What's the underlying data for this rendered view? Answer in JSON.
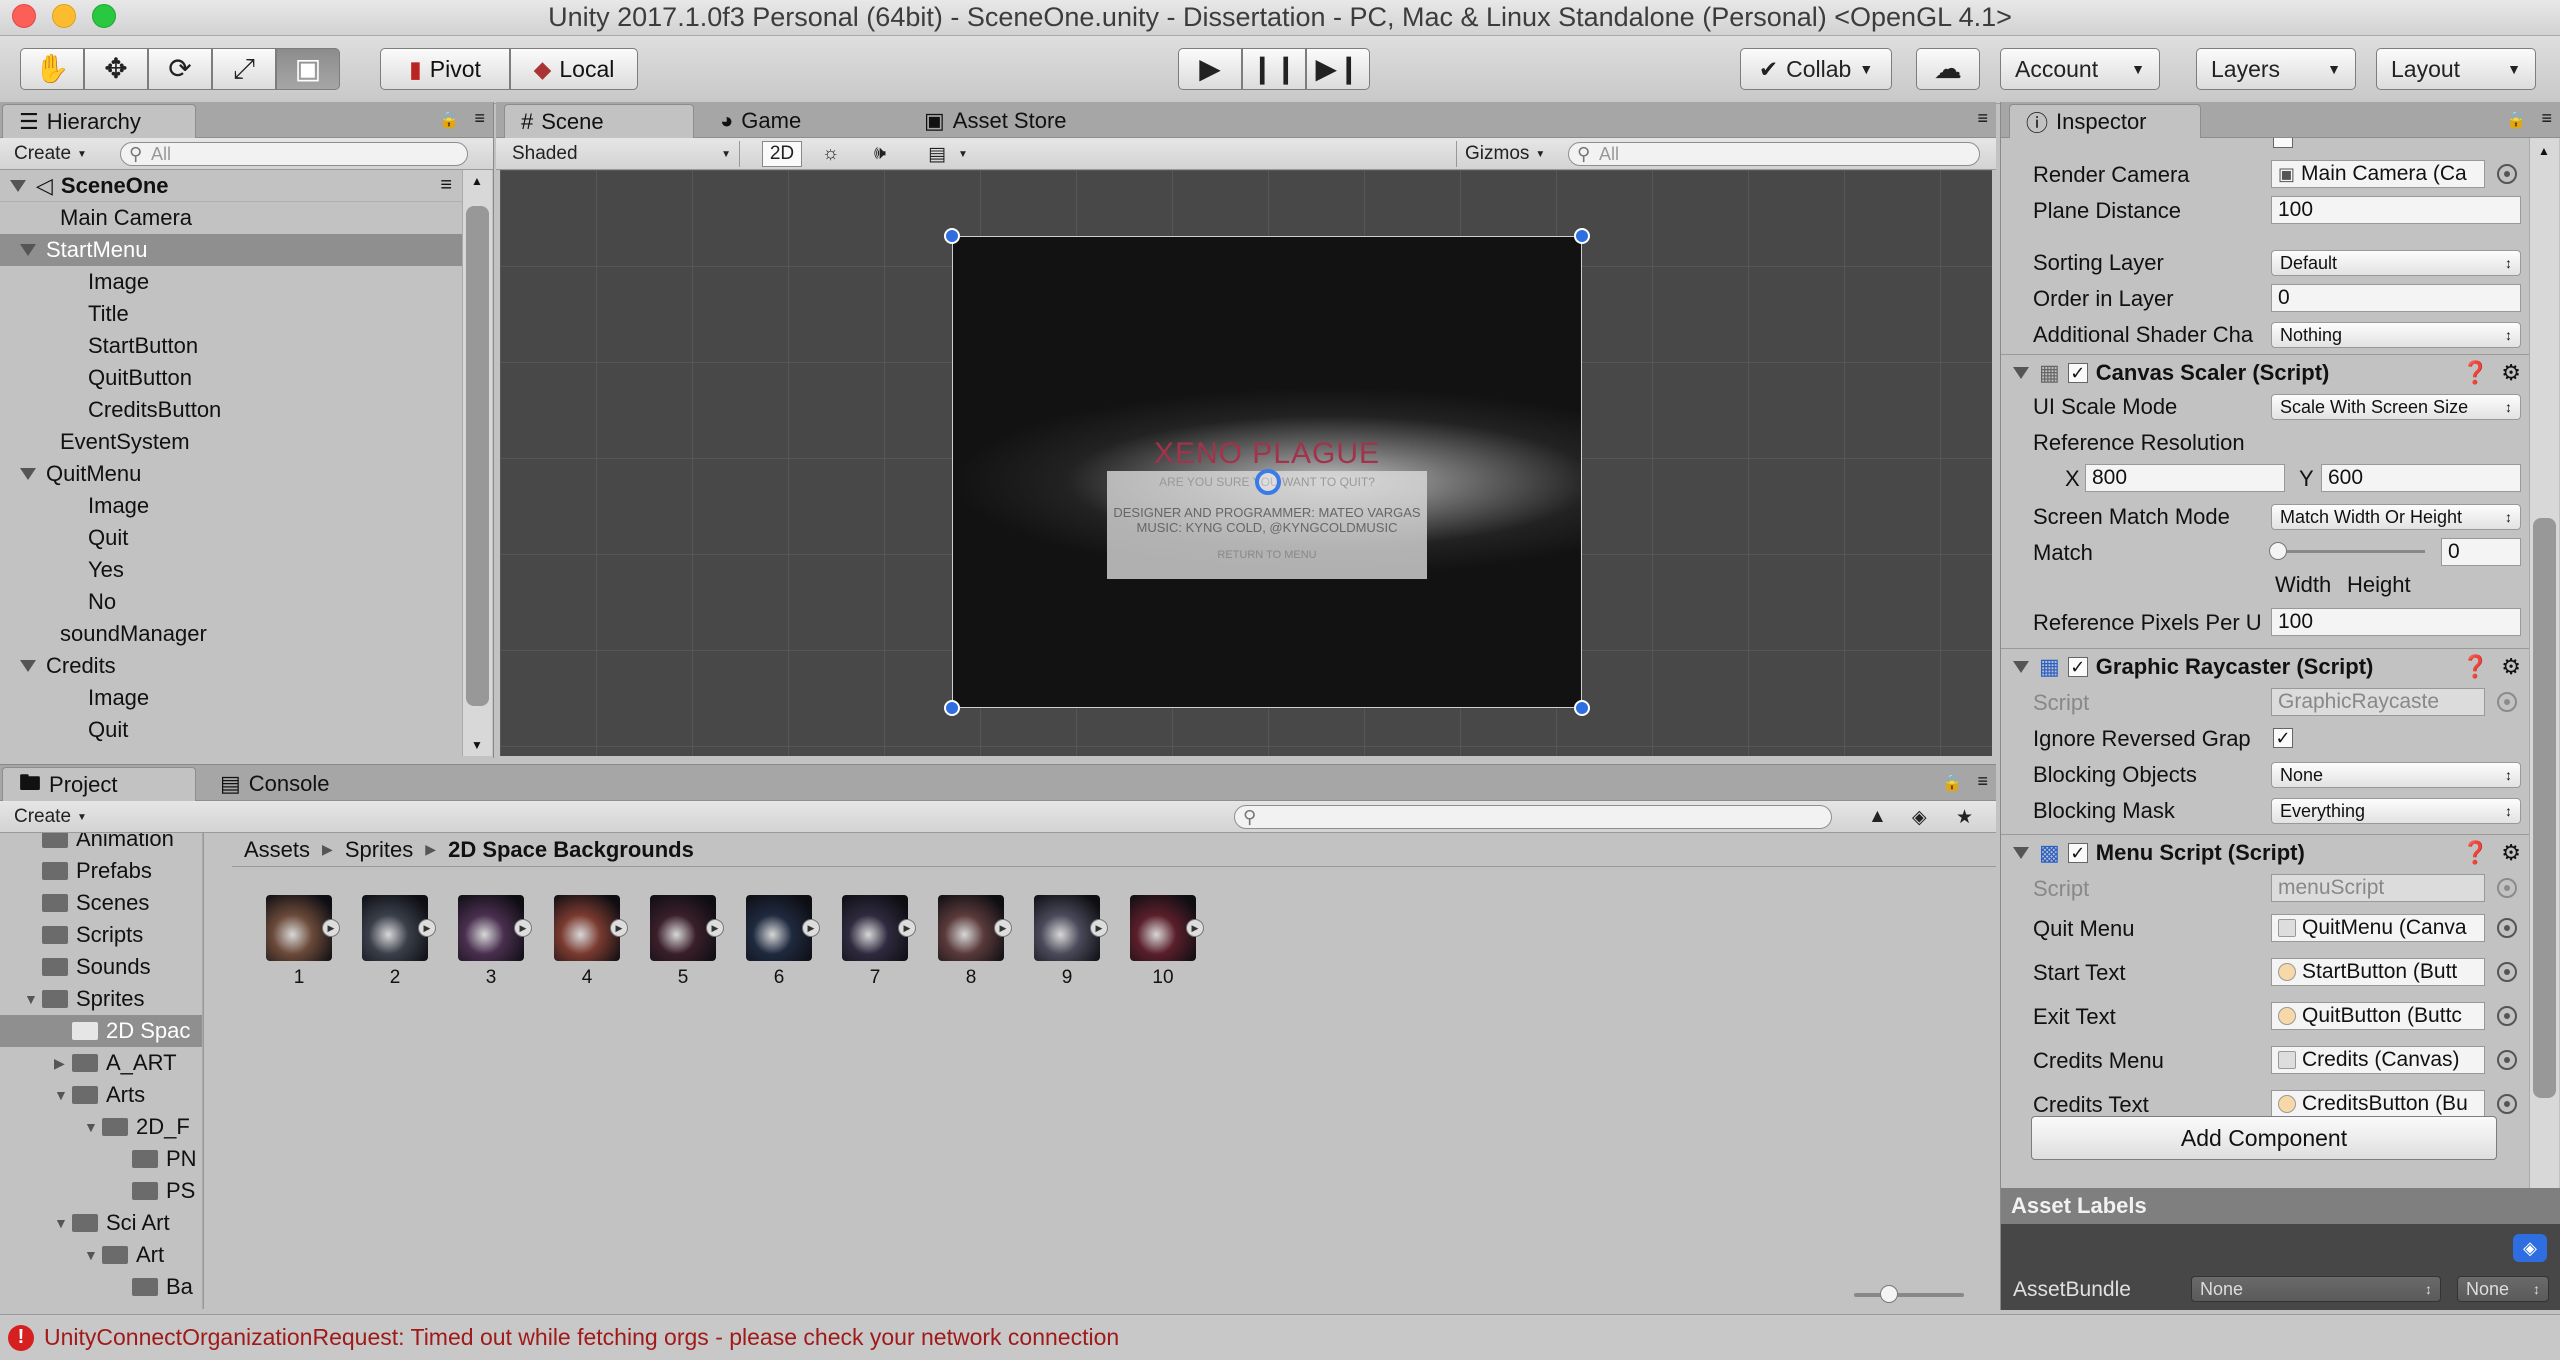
{
  "window": {
    "title": "Unity 2017.1.0f3 Personal (64bit) - SceneOne.unity - Dissertation - PC, Mac & Linux Standalone (Personal) <OpenGL 4.1>"
  },
  "toolbar": {
    "pivot": "Pivot",
    "local": "Local",
    "collab": "Collab",
    "account": "Account",
    "layers": "Layers",
    "layout": "Layout"
  },
  "hierarchy": {
    "tab": "Hierarchy",
    "create": "Create",
    "search_placeholder": "All",
    "scene": "SceneOne",
    "items": [
      {
        "label": "Main Camera",
        "indent": 1
      },
      {
        "label": "StartMenu",
        "indent": 1,
        "expand": true,
        "selected": true
      },
      {
        "label": "Image",
        "indent": 2
      },
      {
        "label": "Title",
        "indent": 2
      },
      {
        "label": "StartButton",
        "indent": 2
      },
      {
        "label": "QuitButton",
        "indent": 2
      },
      {
        "label": "CreditsButton",
        "indent": 2
      },
      {
        "label": "EventSystem",
        "indent": 1
      },
      {
        "label": "QuitMenu",
        "indent": 1,
        "expand": true
      },
      {
        "label": "Image",
        "indent": 2
      },
      {
        "label": "Quit",
        "indent": 2
      },
      {
        "label": "Yes",
        "indent": 2
      },
      {
        "label": "No",
        "indent": 2
      },
      {
        "label": "soundManager",
        "indent": 1
      },
      {
        "label": "Credits",
        "indent": 1,
        "expand": true
      },
      {
        "label": "Image",
        "indent": 2
      },
      {
        "label": "Quit",
        "indent": 2
      }
    ]
  },
  "scene": {
    "tabs": [
      "Scene",
      "Game",
      "Asset Store"
    ],
    "shading": "Shaded",
    "mode2d": "2D",
    "gizmos": "Gizmos",
    "search_placeholder": "All",
    "overlay": {
      "title": "XENO PLAGUE",
      "quit_prompt": "ARE YOU SURE YOU WANT TO QUIT?",
      "credit_line1": "DESIGNER AND PROGRAMMER: MATEO VARGAS",
      "credit_line2": "MUSIC: KYNG COLD, @KYNGCOLDMUSIC",
      "return": "RETURN TO MENU"
    }
  },
  "project": {
    "tabs": [
      "Project",
      "Console"
    ],
    "create": "Create",
    "breadcrumb": [
      "Assets",
      "Sprites",
      "2D Space Backgrounds"
    ],
    "tree": [
      {
        "label": "Animation",
        "indent": 1
      },
      {
        "label": "Prefabs",
        "indent": 1
      },
      {
        "label": "Scenes",
        "indent": 1
      },
      {
        "label": "Scripts",
        "indent": 1
      },
      {
        "label": "Sounds",
        "indent": 1
      },
      {
        "label": "Sprites",
        "indent": 1,
        "expand": "open"
      },
      {
        "label": "2D Spac",
        "indent": 2,
        "selected": true
      },
      {
        "label": "A_ART",
        "indent": 2,
        "expand": "closed"
      },
      {
        "label": "Arts",
        "indent": 2,
        "expand": "open"
      },
      {
        "label": "2D_F",
        "indent": 3,
        "expand": "open"
      },
      {
        "label": "PN",
        "indent": 4
      },
      {
        "label": "PS",
        "indent": 4
      },
      {
        "label": "Sci Art",
        "indent": 2,
        "expand": "open"
      },
      {
        "label": "Art",
        "indent": 3,
        "expand": "open"
      },
      {
        "label": "Ba",
        "indent": 4
      }
    ],
    "assets": [
      "1",
      "2",
      "3",
      "4",
      "5",
      "6",
      "7",
      "8",
      "9",
      "10"
    ],
    "asset_colors": [
      "#6b4a3a",
      "#3a3f4a",
      "#4a2f4f",
      "#7a3a30",
      "#3a1f2a",
      "#1f2a3f",
      "#2f2a3f",
      "#5a3a3a",
      "#4a4a5a",
      "#5a1f2a"
    ]
  },
  "inspector": {
    "tab": "Inspector",
    "rows_top": [
      {
        "label": "Render Camera",
        "value": "Main Camera (Ca",
        "kind": "object"
      },
      {
        "label": "Plane Distance",
        "value": "100",
        "kind": "field"
      },
      {
        "label": "Sorting Layer",
        "value": "Default",
        "kind": "drop"
      },
      {
        "label": "Order in Layer",
        "value": "0",
        "kind": "field"
      },
      {
        "label": "Additional Shader Cha",
        "value": "Nothing",
        "kind": "drop"
      }
    ],
    "canvas_scaler": {
      "title": "Canvas Scaler (Script)",
      "ui_scale_mode_label": "UI Scale Mode",
      "ui_scale_mode": "Scale With Screen Size",
      "ref_res_label": "Reference Resolution",
      "x_label": "X",
      "x": "800",
      "y_label": "Y",
      "y": "600",
      "screen_match_label": "Screen Match Mode",
      "screen_match": "Match Width Or Height",
      "match_label": "Match",
      "match": "0",
      "width_label": "Width",
      "height_label": "Height",
      "ref_ppu_label": "Reference Pixels Per U",
      "ref_ppu": "100"
    },
    "graphic_raycaster": {
      "title": "Graphic Raycaster (Script)",
      "script_label": "Script",
      "script": "GraphicRaycaste",
      "ignore_label": "Ignore Reversed Grap",
      "blocking_objects_label": "Blocking Objects",
      "blocking_objects": "None",
      "blocking_mask_label": "Blocking Mask",
      "blocking_mask": "Everything"
    },
    "menu_script": {
      "title": "Menu Script (Script)",
      "script_label": "Script",
      "script": "menuScript",
      "rows": [
        {
          "label": "Quit Menu",
          "value": "QuitMenu (Canva"
        },
        {
          "label": "Start Text",
          "value": "StartButton (Butt"
        },
        {
          "label": "Exit Text",
          "value": "QuitButton (Buttc"
        },
        {
          "label": "Credits Menu",
          "value": "Credits (Canvas)"
        },
        {
          "label": "Credits Text",
          "value": "CreditsButton (Bu"
        }
      ]
    },
    "add_component": "Add Component",
    "asset_labels": "Asset Labels",
    "asset_bundle_label": "AssetBundle",
    "asset_bundle": "None",
    "asset_bundle_variant": "None"
  },
  "status": {
    "message": "UnityConnectOrganizationRequest: Timed out while fetching orgs - please check your network connection",
    "error_color": "#cc0000"
  }
}
